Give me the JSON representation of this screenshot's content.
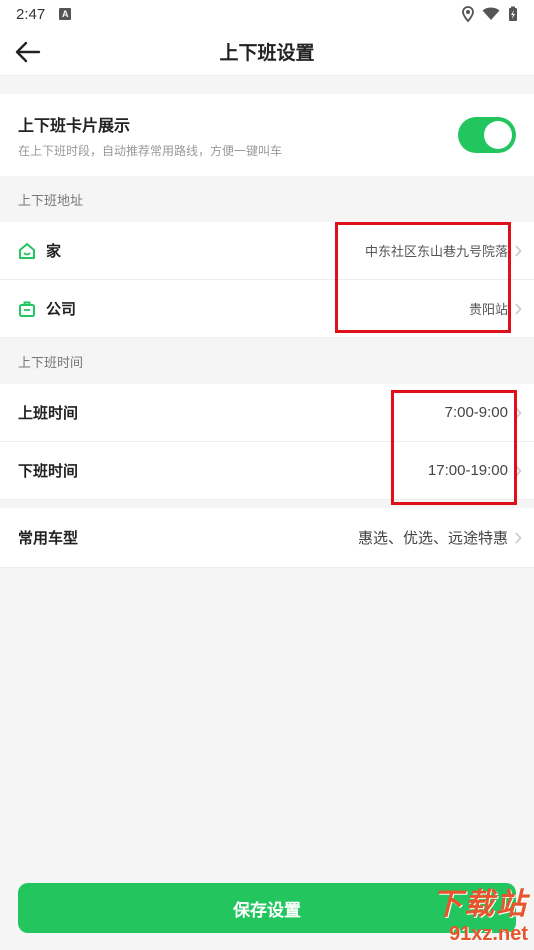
{
  "status_bar": {
    "time": "2:47",
    "a_badge": "A"
  },
  "header": {
    "title": "上下班设置"
  },
  "card_toggle": {
    "title": "上下班卡片展示",
    "description": "在上下班时段，自动推荐常用路线，方便一键叫车",
    "enabled": true
  },
  "address_section": {
    "label": "上下班地址",
    "items": [
      {
        "label": "家",
        "value": "中东社区东山巷九号院落",
        "icon": "home-icon"
      },
      {
        "label": "公司",
        "value": "贵阳站",
        "icon": "briefcase-icon"
      }
    ]
  },
  "time_section": {
    "label": "上下班时间",
    "items": [
      {
        "label": "上班时间",
        "value": "7:00-9:00"
      },
      {
        "label": "下班时间",
        "value": "17:00-19:00"
      }
    ]
  },
  "car_type": {
    "label": "常用车型",
    "value": "惠选、优选、远途特惠"
  },
  "save_button": {
    "label": "保存设置"
  },
  "watermark": {
    "logo": "下载站",
    "url": "91xz.net"
  },
  "colors": {
    "accent": "#22c55e",
    "highlight": "#e0101a"
  }
}
